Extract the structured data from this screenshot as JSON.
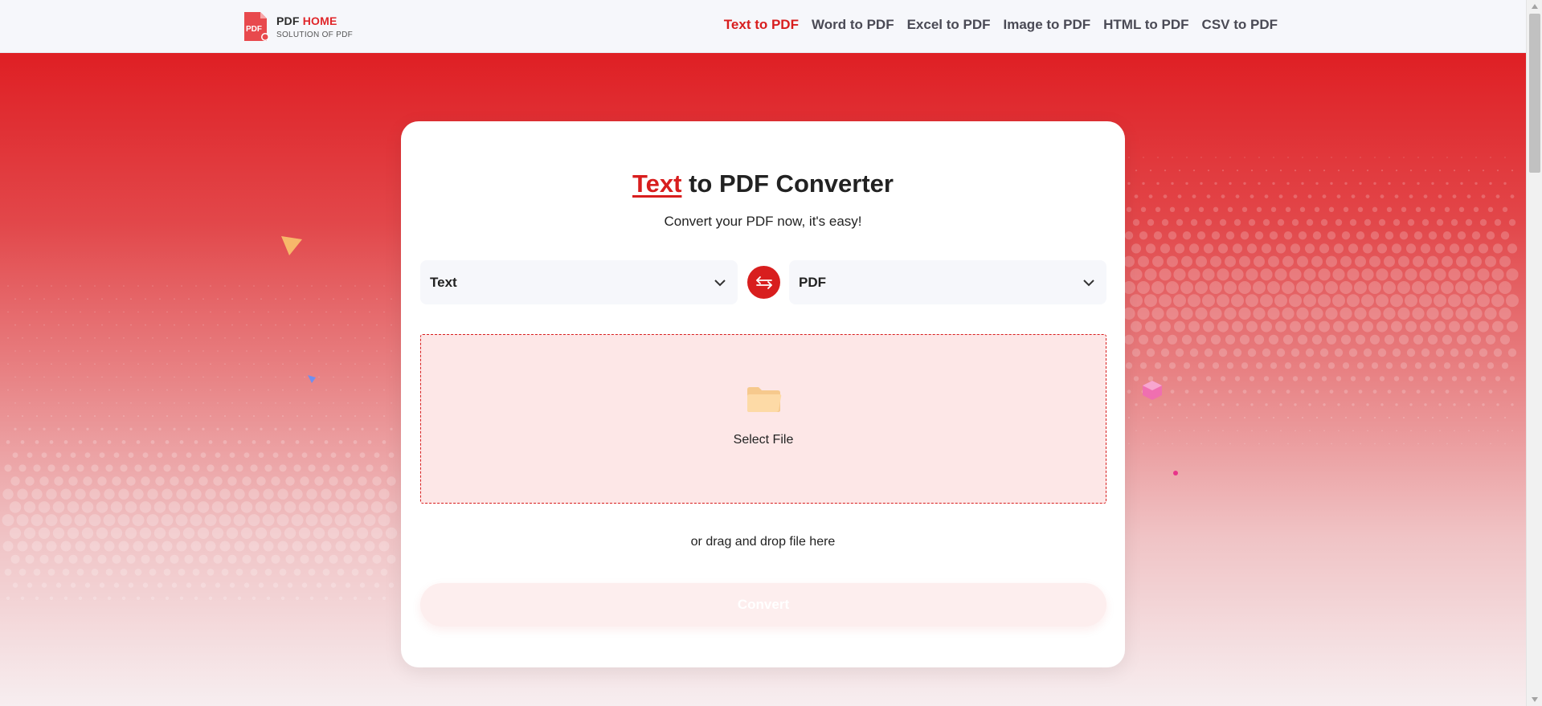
{
  "header": {
    "logo": {
      "badge_text": "PDF",
      "brand_part1": "PDF ",
      "brand_part2": "HOME",
      "tagline": "SOLUTION OF PDF"
    },
    "nav": [
      {
        "label": "Text to PDF",
        "active": true
      },
      {
        "label": "Word to PDF",
        "active": false
      },
      {
        "label": "Excel to PDF",
        "active": false
      },
      {
        "label": "Image to PDF",
        "active": false
      },
      {
        "label": "HTML to PDF",
        "active": false
      },
      {
        "label": "CSV to PDF",
        "active": false
      }
    ]
  },
  "converter": {
    "title_highlight": "Text",
    "title_rest": " to PDF Converter",
    "subtitle": "Convert your PDF now, it's easy!",
    "from_format": "Text",
    "to_format": "PDF",
    "dropzone_label": "Select File",
    "drag_text": "or drag and drop file here",
    "convert_label": "Convert"
  },
  "colors": {
    "accent": "#d81e1e",
    "dropzone_bg": "#fde7e7",
    "select_bg": "#f6f7fb"
  },
  "icons": {
    "logo": "pdf-file-icon",
    "swap": "swap-arrows-icon",
    "select_arrow": "chevron-down-icon",
    "dropzone": "folder-icon"
  }
}
